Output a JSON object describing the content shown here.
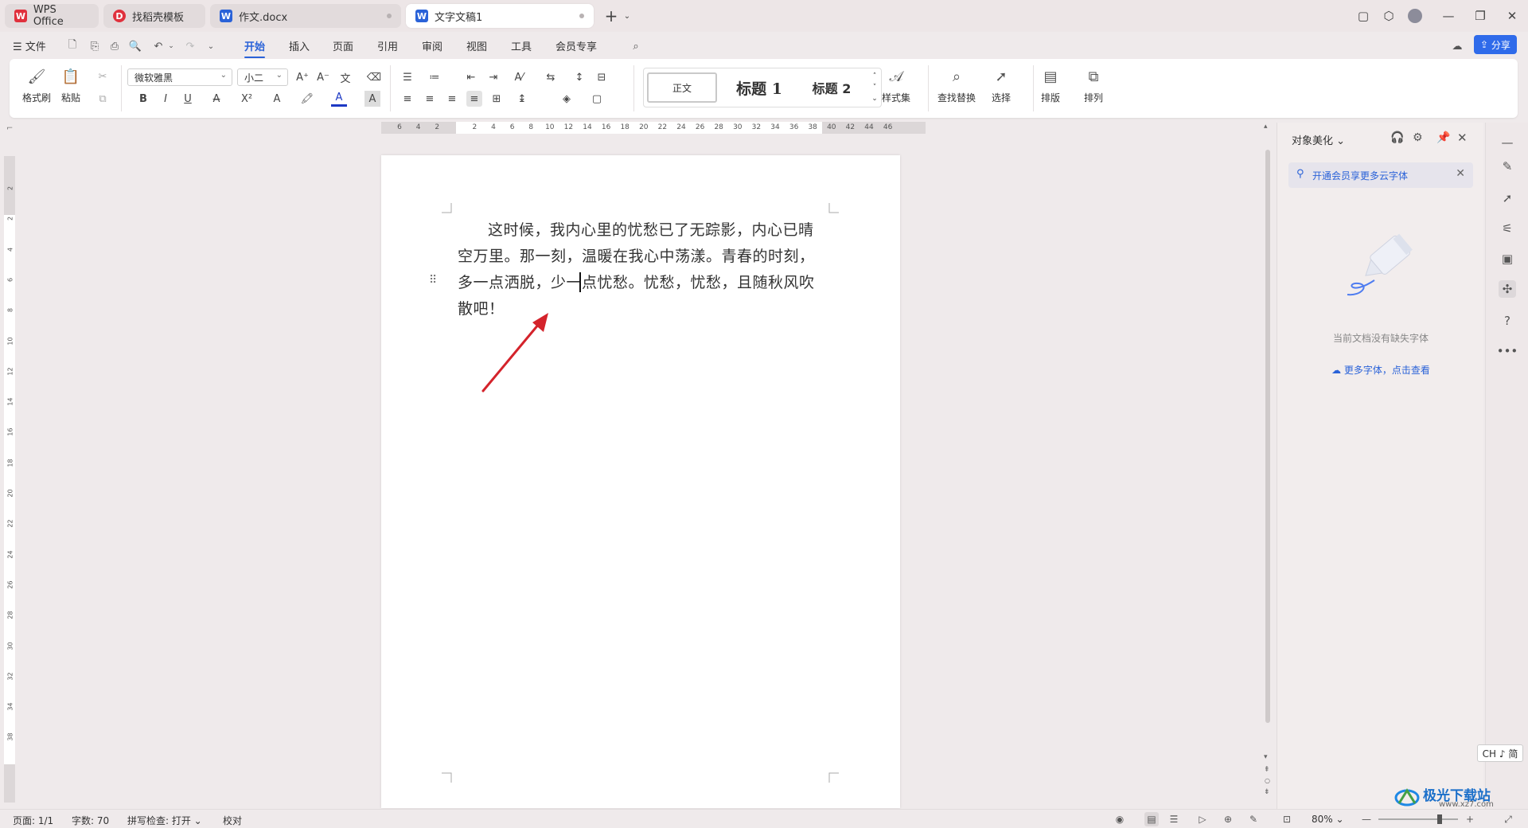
{
  "tabs": [
    {
      "label": "WPS Office",
      "icon": "wps-logo-icon",
      "color": "#e0313d"
    },
    {
      "label": "找稻壳模板",
      "icon": "docer-icon",
      "color": "#e0313d"
    },
    {
      "label": "作文.docx",
      "icon": "word-doc-icon",
      "color": "#2a62d8"
    },
    {
      "label": "文字文稿1",
      "icon": "word-doc-icon",
      "color": "#2a62d8",
      "active": true
    }
  ],
  "menu": {
    "file": "文件",
    "items": [
      "开始",
      "插入",
      "页面",
      "引用",
      "审阅",
      "视图",
      "工具",
      "会员专享"
    ],
    "active": "开始",
    "share": "分享"
  },
  "ribbon": {
    "format_painter": "格式刷",
    "paste": "粘贴",
    "font_name": "微软雅黑",
    "font_size": "小二",
    "styles": [
      "正文",
      "标题 1",
      "标题 2"
    ],
    "style_set": "样式集",
    "find_replace": "查找替换",
    "select": "选择",
    "layout": "排版",
    "arrange": "排列"
  },
  "ruler": {
    "h_ticks": [
      "6",
      "4",
      "2",
      "",
      "2",
      "4",
      "6",
      "8",
      "10",
      "12",
      "14",
      "16",
      "18",
      "20",
      "22",
      "24",
      "26",
      "28",
      "30",
      "32",
      "34",
      "36",
      "38",
      "40",
      "42",
      "44",
      "46"
    ],
    "v_ticks": [
      "2",
      "2",
      "4",
      "6",
      "8",
      "10",
      "12",
      "14",
      "16",
      "18",
      "20",
      "22",
      "24",
      "26",
      "28",
      "30",
      "32",
      "34",
      "38"
    ]
  },
  "document": {
    "text": "这时候，我内心里的忧愁已了无踪影，内心已晴空万里。那一刻，温暖在我心中荡漾。青春的时刻，多一点洒脱，少一点忧愁。忧愁，忧愁，且随秋风吹散吧！"
  },
  "panel": {
    "title": "对象美化",
    "promo": "开通会员享更多云字体",
    "empty_message": "当前文档没有缺失字体",
    "more_fonts_link": "更多字体，点击查看"
  },
  "status": {
    "page": "页面: 1/1",
    "word_count": "字数: 70",
    "spell_check": "拼写检查: 打开",
    "proofread": "校对",
    "zoom": "80%"
  },
  "ime": "CH ♪ 简",
  "watermark": {
    "name": "极光下载站",
    "url": "www.xz7.com"
  },
  "colors": {
    "accent": "#2a62d8",
    "wps_red": "#e0313d",
    "arrow": "#d4232b"
  }
}
